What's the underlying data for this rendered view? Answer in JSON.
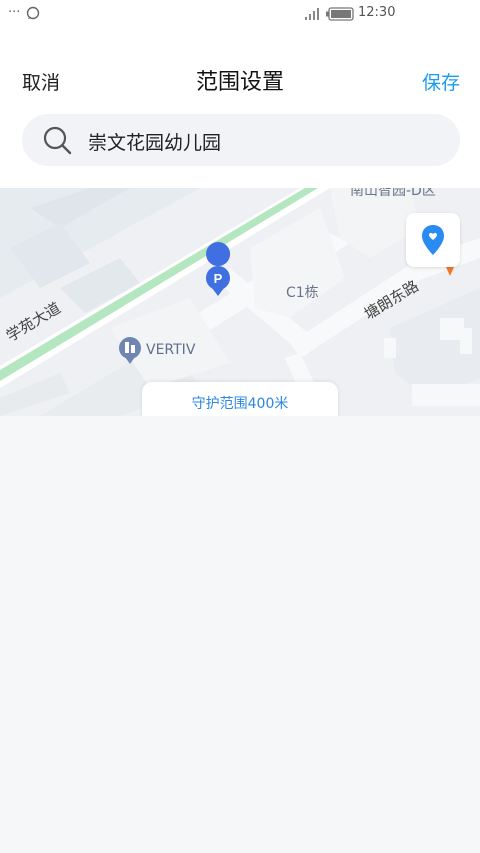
{
  "status": {
    "time": "12:30"
  },
  "header": {
    "cancel_label": "取消",
    "title": "范围设置",
    "save_label": "保存"
  },
  "search": {
    "value": "崇文花园幼儿园"
  },
  "map": {
    "labels": {
      "road_xueyuan": "学苑大道",
      "road_tanglang": "塘朗东路",
      "building_c1": "C1栋",
      "poi_vertiv": "VERTIV",
      "poi_top": "南山智园-D区"
    }
  },
  "range": {
    "label": "守护范围400米"
  },
  "colors": {
    "accent": "#1a9df0",
    "range_text": "#2b87e0",
    "road_green": "#a9e2b5"
  }
}
